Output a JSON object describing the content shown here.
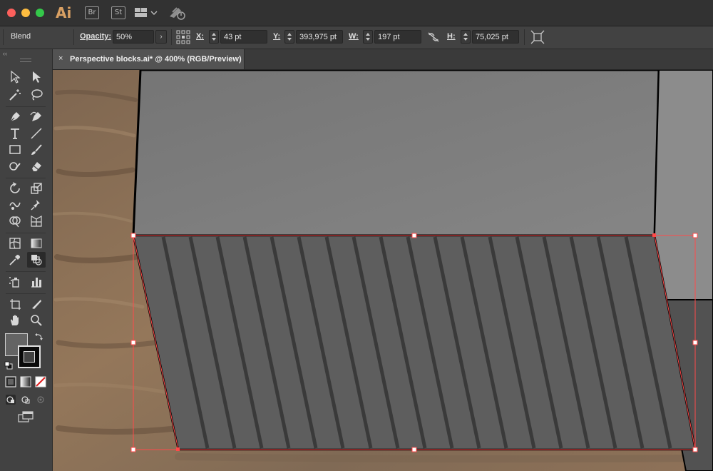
{
  "app": {
    "logo": "Ai",
    "bridge_label": "Br",
    "stock_label": "St",
    "workspace_icon": "layout-grid-icon",
    "sync_icon": "gpu-sync-icon"
  },
  "control_bar": {
    "selection_type": "Blend",
    "opacity_label": "Opacity:",
    "opacity_value": "50%",
    "x_label": "X:",
    "x_value": "43 pt",
    "y_label": "Y:",
    "y_value": "393,975 pt",
    "w_label": "W:",
    "w_value": "197 pt",
    "h_label": "H:",
    "h_value": "75,025 pt"
  },
  "document": {
    "tab_title": "Perspective blocks.ai* @ 400% (RGB/Preview)",
    "close_glyph": "×"
  },
  "tools_panel": {
    "collapse_glyph": "‹‹",
    "fill_color": "#646464",
    "stroke_color": "#0a0a0a"
  },
  "colors": {
    "selection": "#ff4a4a",
    "top_face": "#7d7d7d",
    "front_face": "#5e5e5e",
    "stripe": "#3a3a3a",
    "wood": "#8a6f55"
  }
}
